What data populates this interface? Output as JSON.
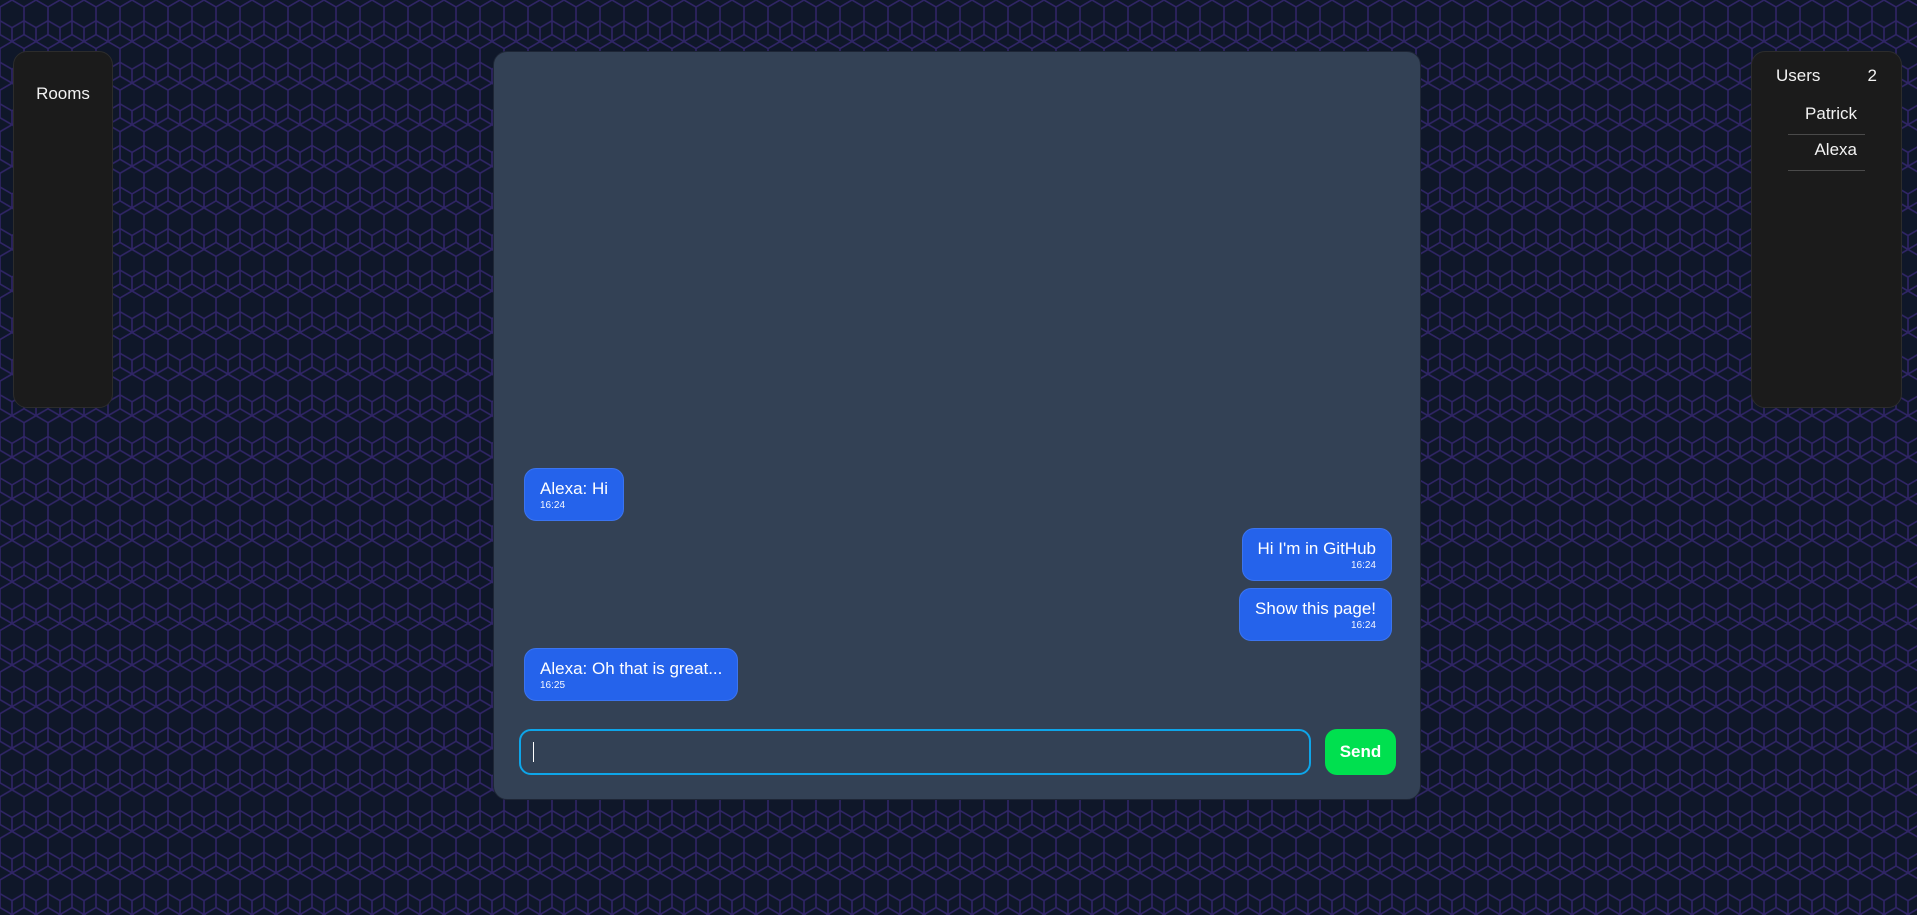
{
  "colors": {
    "background": "#0f1729",
    "hex_pattern_stroke": "#3b2a7a",
    "panel_dark": "#1b1b1b",
    "chat_panel": "#334155",
    "message_bubble": "#2563eb",
    "input_border": "#0ea5e9",
    "send_button": "#00e04f"
  },
  "rooms": {
    "title": "Rooms"
  },
  "users": {
    "title": "Users",
    "count": "2",
    "list": [
      "Patrick",
      "Alexa"
    ]
  },
  "chat": {
    "messages": [
      {
        "text": "Alexa: Hi",
        "time": "16:24",
        "own": false
      },
      {
        "text": "Hi I'm in GitHub",
        "time": "16:24",
        "own": true
      },
      {
        "text": "Show this page!",
        "time": "16:24",
        "own": true
      },
      {
        "text": "Alexa: Oh that is great...",
        "time": "16:25",
        "own": false
      }
    ],
    "input": {
      "value": "",
      "placeholder": ""
    },
    "send_label": "Send"
  }
}
